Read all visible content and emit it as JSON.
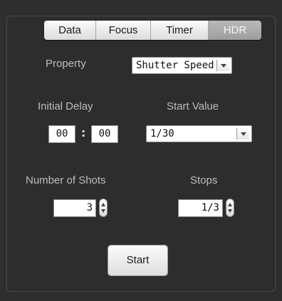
{
  "tabs": [
    {
      "label": "Data",
      "selected": false
    },
    {
      "label": "Focus",
      "selected": false
    },
    {
      "label": "Timer",
      "selected": false
    },
    {
      "label": "HDR",
      "selected": true
    }
  ],
  "property": {
    "label": "Property",
    "value": "Shutter Speed"
  },
  "initial_delay": {
    "label": "Initial Delay",
    "minutes": "00",
    "separator": ":",
    "seconds": "00"
  },
  "start_value": {
    "label": "Start Value",
    "value": "1/30"
  },
  "number_of_shots": {
    "label": "Number of Shots",
    "value": "3"
  },
  "stops": {
    "label": "Stops",
    "value": "1/3"
  },
  "start_button": {
    "label": "Start"
  },
  "colors": {
    "background": "#2e2e2e",
    "label_text": "#bdbdbd",
    "selected_tab": "#a8a8a8"
  }
}
